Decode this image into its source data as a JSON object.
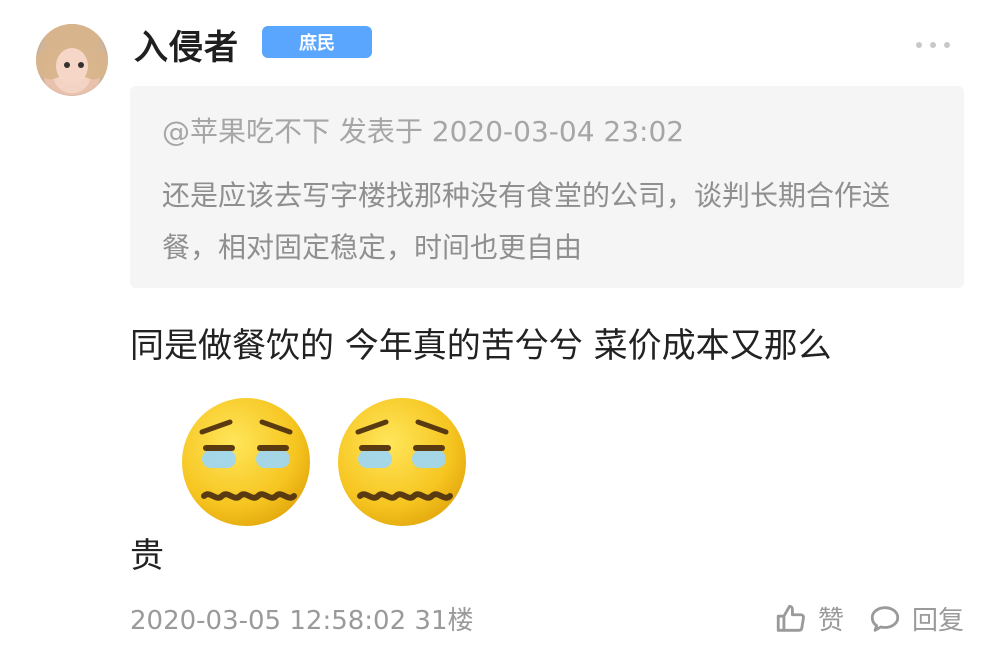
{
  "post": {
    "username": "入侵者",
    "badge": "庶民",
    "quote": {
      "meta": "@苹果吃不下 发表于 2020-03-04 23:02",
      "text": "还是应该去写字楼找那种没有食堂的公司，谈判长期合作送餐，相对固定稳定，时间也更自由"
    },
    "content_line1": "同是做餐饮的 今年真的苦兮兮 菜价成本又那么",
    "content_tail": "贵",
    "footer": {
      "timestamp_and_floor": "2020-03-05 12:58:02  31楼",
      "like_label": "赞",
      "reply_label": "回复"
    },
    "icons": {
      "more": "more-icon",
      "like": "thumbs-up-icon",
      "reply": "comment-bubble-icon",
      "emoji": "exhausted-face-emoji"
    },
    "colors": {
      "badge_bg": "#5aa6ff",
      "quote_bg": "#f5f5f5",
      "muted_text": "#9a9a9a"
    }
  }
}
